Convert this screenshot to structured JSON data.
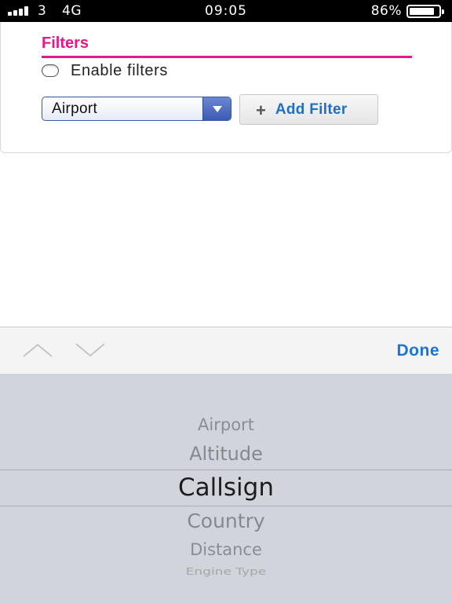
{
  "status_bar": {
    "carrier": "3",
    "network": "4G",
    "time": "09:05",
    "battery_percent": "86%",
    "battery_level": 0.86,
    "signal_bars": 4
  },
  "filters": {
    "title": "Filters",
    "enable_label": "Enable filters",
    "enabled": false,
    "select_value": "Airport",
    "add_button_label": "Add Filter"
  },
  "toolbar": {
    "prev_icon": "chevron-up-icon",
    "next_icon": "chevron-down-icon",
    "done_label": "Done"
  },
  "picker": {
    "selected": "Callsign",
    "items": [
      "Airport",
      "Altitude",
      "Callsign",
      "Country",
      "Distance",
      "Engine Type"
    ]
  },
  "colors": {
    "accent_pink": "#e4188b",
    "link_blue": "#1f6fc2",
    "done_blue": "#1a75d9",
    "select_border": "#3a58a8"
  }
}
